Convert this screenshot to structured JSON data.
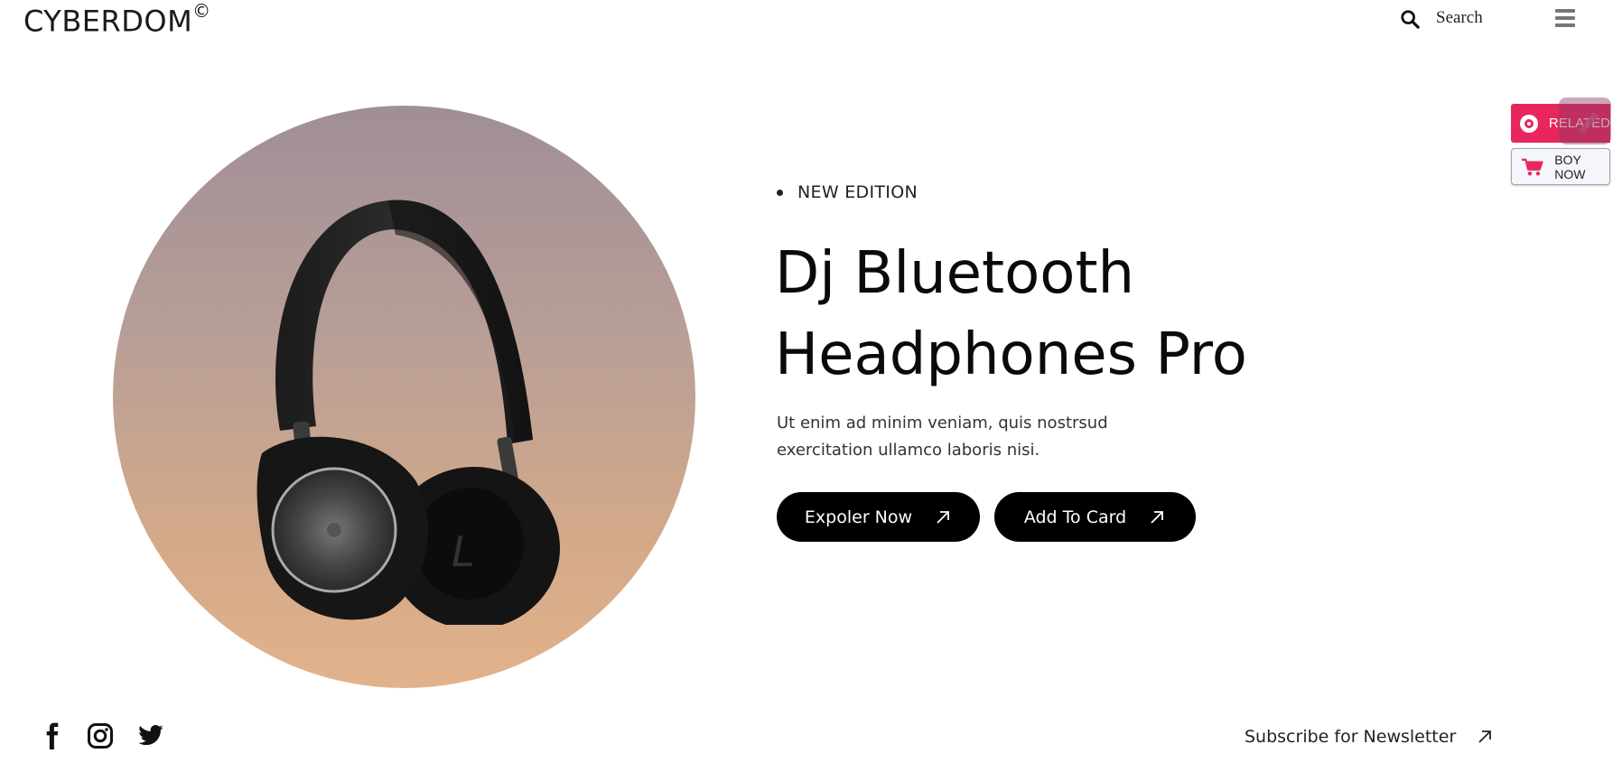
{
  "header": {
    "logo_text": "CYBERDOM",
    "logo_mark": "©",
    "search_label": "Search",
    "search_icon": "search-icon",
    "menu_icon": "hamburger-menu-icon"
  },
  "hero": {
    "image_icon": "headphones-product-image",
    "badge": "NEW EDITION",
    "title_line1": "Dj Bluetooth",
    "title_line2": "Headphones Pro",
    "description": "Ut enim ad minim veniam, quis nostrsud exercitation ullamco laboris nisi.",
    "buttons": {
      "explore_label": "Expoler Now",
      "add_label": "Add To Card"
    }
  },
  "side_widgets": {
    "related_label": "RELATED",
    "buy_label": "BOY NOW",
    "related_color": "#e8265e",
    "buy_icon_color": "#e8265e"
  },
  "footer": {
    "social": [
      "facebook-icon",
      "instagram-icon",
      "twitter-icon"
    ],
    "newsletter_label": "Subscribe for Newsletter"
  },
  "colors": {
    "circle_top": "#a08e98",
    "circle_bottom": "#e2b28b",
    "button_bg": "#000000",
    "accent": "#e8265e"
  }
}
